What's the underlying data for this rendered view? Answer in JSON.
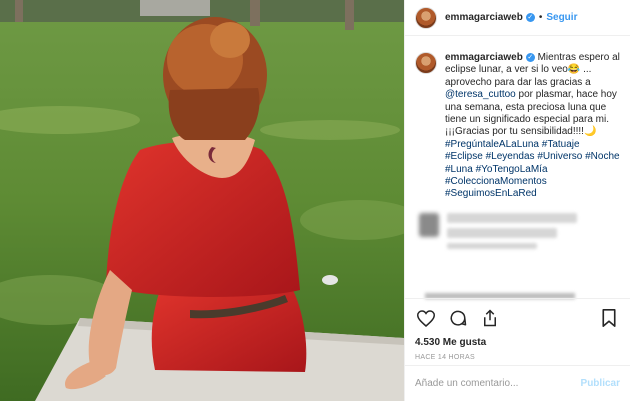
{
  "header": {
    "username": "emmagarciaweb",
    "separator": "•",
    "follow_label": "Seguir"
  },
  "caption": {
    "username": "emmagarciaweb",
    "text_1": " Mientras espero al eclipse lunar, a ver si lo veo",
    "emoji_1": "😂",
    "text_2": " ... aprovecho para dar las gracias a ",
    "mention": "@teresa_cuttoo",
    "text_3": " por plasmar, hace hoy una semana, esta preciosa luna que tiene un significado especial para mi. ¡¡¡Gracias por tu sensibilidad!!!!",
    "emoji_2": "🌙",
    "hashtags": [
      "#PregúntaleALaLuna",
      "#Tatuaje",
      "#Eclipse",
      "#Leyendas",
      "#Universo",
      "#Noche",
      "#Luna",
      "#YoTengoLaMía",
      "#ColeccionaMomentos",
      "#SeguimosEnLaRed"
    ]
  },
  "actions": {
    "likes": "4.530 Me gusta",
    "timestamp": "HACE 14 HORAS"
  },
  "comment_box": {
    "placeholder": "Añade un comentario...",
    "publish_label": "Publicar"
  },
  "icons": [
    "heart-icon",
    "comment-icon",
    "share-icon",
    "bookmark-icon",
    "verified-badge-icon"
  ]
}
